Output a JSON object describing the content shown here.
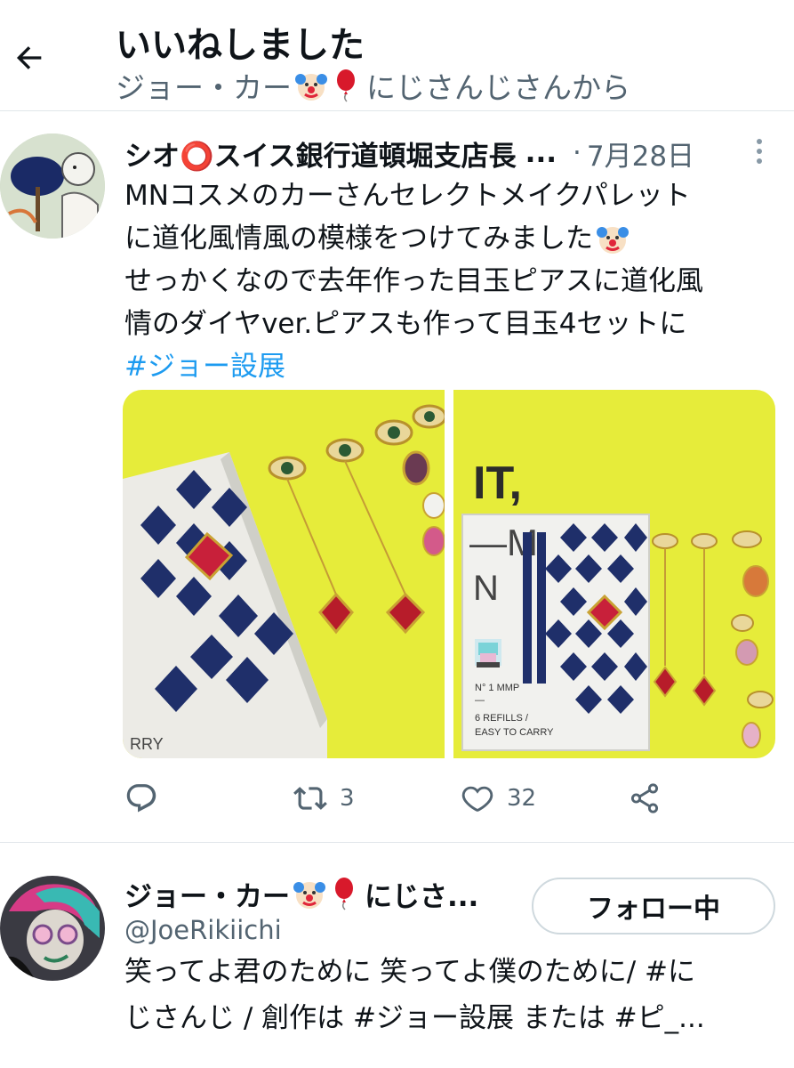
{
  "header": {
    "title": "いいねしました",
    "subtitle_prefix": "ジョー・カー",
    "subtitle_suffix": "にじさんじさんから",
    "back_icon": "arrow-left-icon"
  },
  "tweet": {
    "author_name": "シオ⭕スイス銀行道頓堀支店長",
    "author_name_truncation": "...",
    "separator": "·",
    "date": "7月28日",
    "body_lines": [
      "MNコスメのカーさんセレクトメイクパレット",
      "に道化風情風の模様をつけてみました",
      "せっかくなので去年作った目玉ピアスに道化風",
      "情のダイヤver.ピアスも作って目玉4セットに"
    ],
    "hashtag": "#ジョー設展",
    "image_text": {
      "left_corner": "RRY",
      "right_top": "IT,",
      "right_m": "—M",
      "right_n": "N",
      "right_model": "N° 1 MMP",
      "right_dash": "—",
      "right_refills": "6 REFILLS /",
      "right_carry": "EASY TO CARRY"
    },
    "actions": {
      "reply_count": "",
      "retweet_count": "3",
      "like_count": "32"
    }
  },
  "follow_card": {
    "name_prefix": "ジョー・カー",
    "name_suffix": "にじさ...",
    "handle": "@JoeRikiichi",
    "follow_label": "フォロー中",
    "bio_lines": [
      "笑ってよ君のために 笑ってよ僕のために/ #に",
      "じさんじ / 創作は #ジョー設展 または #ピ_..."
    ]
  },
  "colors": {
    "accent": "#1d9bf0",
    "secondary_text": "#536471",
    "primary_text": "#0f1419",
    "divider": "#e1e6ea",
    "photo_background": "#e6ec3a"
  }
}
